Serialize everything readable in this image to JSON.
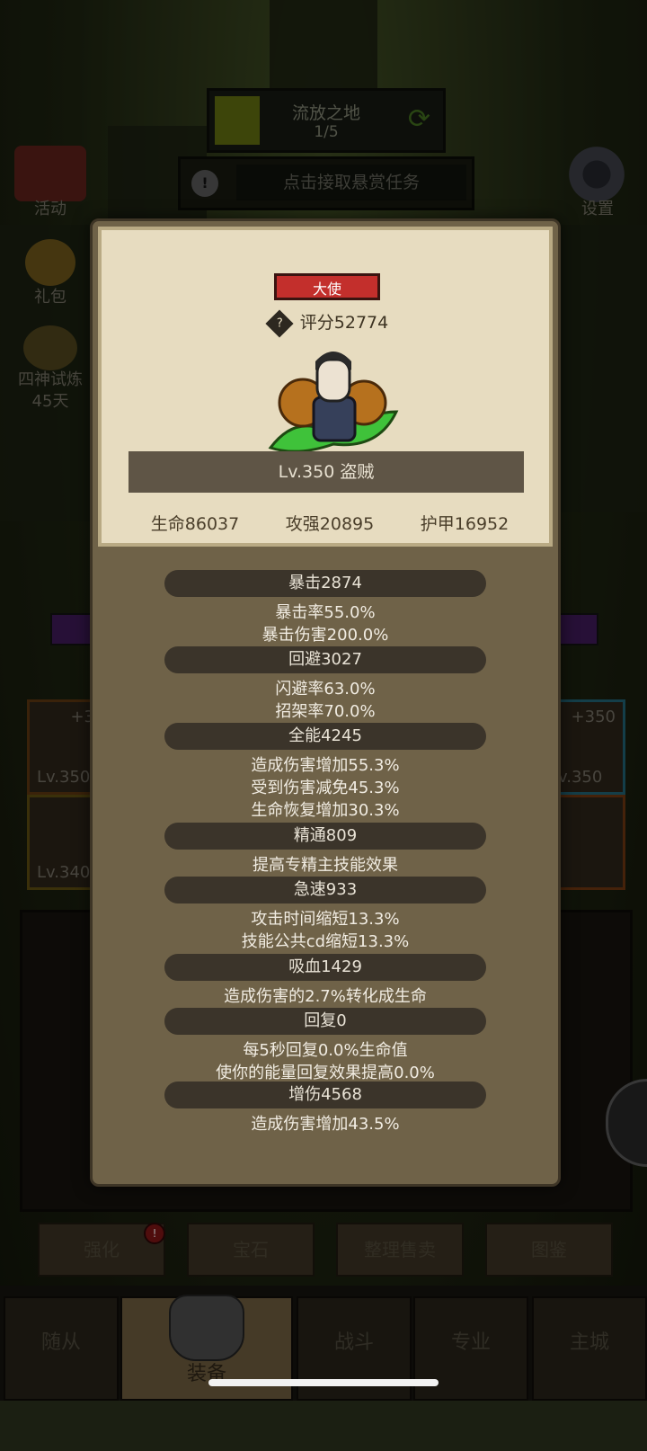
{
  "hud": {
    "stage_name": "流放之地",
    "stage_progress": "1/5",
    "bounty_text": "点击接取悬赏任务",
    "settings_label": "设置"
  },
  "side": [
    {
      "label": "活动"
    },
    {
      "label": "礼包"
    },
    {
      "label": "四神试炼"
    },
    {
      "label": "45天"
    }
  ],
  "background_cards": {
    "left1_plus": "+3",
    "left1_lv": "Lv.350",
    "left2_lv": "Lv.340",
    "right1_plus": "+350",
    "right1_lv": "v.350"
  },
  "bottom_buttons": [
    "强化",
    "宝石",
    "整理售卖",
    "图鉴"
  ],
  "bottom_tabs": [
    "随从",
    "装备",
    "战斗",
    "专业",
    "主城"
  ],
  "popup": {
    "rank": "大使",
    "score_label": "评分52774",
    "help_glyph": "?",
    "level_class": "Lv.350 盗贼",
    "main_stats": [
      "生命86037",
      "攻强20895",
      "护甲16952"
    ],
    "sections": [
      {
        "title": "暴击2874",
        "lines": [
          "暴击率55.0%",
          "暴击伤害200.0%"
        ]
      },
      {
        "title": "回避3027",
        "lines": [
          "闪避率63.0%",
          "招架率70.0%"
        ]
      },
      {
        "title": "全能4245",
        "lines": [
          "造成伤害增加55.3%",
          "受到伤害减免45.3%",
          "生命恢复增加30.3%"
        ]
      },
      {
        "title": "精通809",
        "lines": [
          "提高专精主技能效果"
        ]
      },
      {
        "title": "急速933",
        "lines": [
          "攻击时间缩短13.3%",
          "技能公共cd缩短13.3%"
        ]
      },
      {
        "title": "吸血1429",
        "lines": [
          "造成伤害的2.7%转化成生命"
        ]
      },
      {
        "title": "回复0",
        "lines": [
          "每5秒回复0.0%生命值",
          "使你的能量回复效果提高0.0%"
        ]
      },
      {
        "title": "增伤4568",
        "lines": [
          "造成伤害增加43.5%"
        ]
      }
    ]
  }
}
